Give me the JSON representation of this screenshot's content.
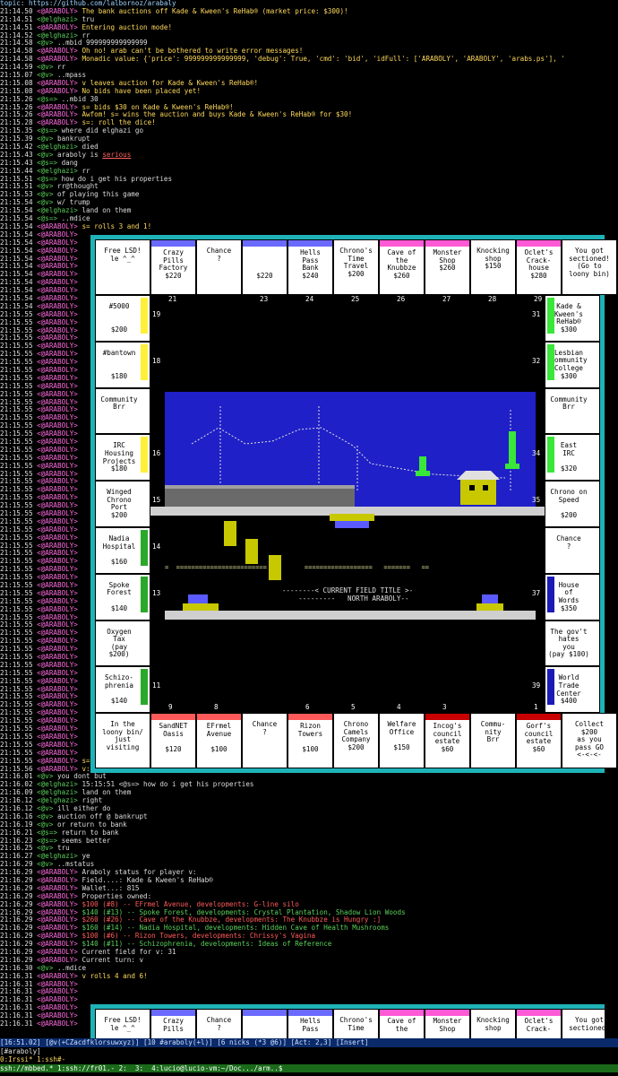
{
  "topic": "topic: https://github.com/lalbornoz/arabaly",
  "log": [
    [
      "21:14.50",
      "ARABOLY",
      "The bank auctions off Kade & Kween's ReHab® (market price: $300)!",
      "bot"
    ],
    [
      "21:14.51",
      "elghazi",
      "tru",
      "nk"
    ],
    [
      "21:14.51",
      "ARABOLY",
      "Entering auction mode!",
      "bot"
    ],
    [
      "21:14.52",
      "elghazi",
      "rr",
      "nk"
    ],
    [
      "21:14.58",
      "v",
      "..mbid 999999999999999",
      "nk"
    ],
    [
      "21:14.58",
      "ARABOLY",
      "Oh no! arab can't be bothered to write error messages!",
      "bot"
    ],
    [
      "21:14.58",
      "ARABOLY",
      "Monadic value: {'price': 999999999999999, 'debug': True, 'cmd': 'bid', 'idFull': ['ARABOLY', 'ARABOLY', 'arabs.ps'], '",
      "bot"
    ],
    [
      "21:14.59",
      "v",
      "rr",
      "nk"
    ],
    [
      "21:15.07",
      "v",
      "..mpass",
      "nk"
    ],
    [
      "21:15.08",
      "ARABOLY",
      "v leaves auction for Kade & Kween's ReHab®!",
      "bot"
    ],
    [
      "21:15.08",
      "ARABOLY",
      "No bids have been placed yet!",
      "bot"
    ],
    [
      "21:15.26",
      "s=",
      "..mbid 30",
      "nk"
    ],
    [
      "21:15.26",
      "ARABOLY",
      "s= bids $30 on Kade & Kween's ReHab®!",
      "bot"
    ],
    [
      "21:15.26",
      "ARABOLY",
      "Awfom! s= wins the auction and buys Kade & Kween's ReHab® for $30!",
      "bot"
    ],
    [
      "21:15.28",
      "ARABOLY",
      "s=: roll the dice!",
      "bot"
    ],
    [
      "21:15.35",
      "s=",
      "where did elghazi go",
      "nk"
    ],
    [
      "21:15.39",
      "v",
      "bankrupt",
      "nk"
    ],
    [
      "21:15.42",
      "elghazi",
      "died",
      "nk"
    ],
    [
      "21:15.43",
      "v",
      "araboly is ",
      "nk",
      "serious"
    ],
    [
      "21:15.43",
      "s=",
      "dang",
      "nk"
    ],
    [
      "21:15.44",
      "elghazi",
      "rr",
      "nk"
    ],
    [
      "21:15.51",
      "s=",
      "how do i get his properties",
      "nk"
    ],
    [
      "21:15.51",
      "v",
      "rr@thought",
      "nk"
    ],
    [
      "21:15.53",
      "v",
      "of playing this game",
      "nk"
    ],
    [
      "21:15.54",
      "v",
      "w/ trump",
      "nk"
    ],
    [
      "21:15.54",
      "elghazi",
      "land on them",
      "nk"
    ],
    [
      "21:15.54",
      "s=",
      "..mdice",
      "nk"
    ],
    [
      "21:15.54",
      "ARABOLY",
      "s= rolls 3 and 1!",
      "bot"
    ]
  ],
  "filler_times": [
    "21:15.54",
    "21:15.54",
    "21:15.54",
    "21:15.54",
    "21:15.54",
    "21:15.54",
    "21:15.54",
    "21:15.54",
    "21:15.54",
    "21:15.54",
    "21:15.55",
    "21:15.55",
    "21:15.55",
    "21:15.55",
    "21:15.55",
    "21:15.55",
    "21:15.55",
    "21:15.55",
    "21:15.55",
    "21:15.55",
    "21:15.55",
    "21:15.55",
    "21:15.55",
    "21:15.55",
    "21:15.55",
    "21:15.55",
    "21:15.55",
    "21:15.55",
    "21:15.55",
    "21:15.55",
    "21:15.55",
    "21:15.55",
    "21:15.55",
    "21:15.55",
    "21:15.55",
    "21:15.55",
    "21:15.55",
    "21:15.55",
    "21:15.55",
    "21:15.55",
    "21:15.55",
    "21:15.55",
    "21:15.55",
    "21:15.55",
    "21:15.55",
    "21:15.55",
    "21:15.55",
    "21:15.55",
    "21:15.55",
    "21:15.55",
    "21:15.55",
    "21:15.55",
    "21:15.55",
    "21:15.55",
    "21:15.55",
    "21:15.55",
    "21:15.55",
    "21:15.55",
    "21:15.55",
    "21:15.55",
    "21:15.55",
    "21:15.55",
    "21:15.55",
    "21:15.55",
    "21:15.55",
    "21:15.55"
  ],
  "log2": [
    [
      "21:15.55",
      "ARABOLY",
      "s= lands on Oclet's Crackhouse!",
      "bot"
    ],
    [
      "21:15.56",
      "ARABOLY",
      "v: roll the dice!",
      "bot"
    ],
    [
      "21:16.01",
      "v",
      "you dont but",
      "nk"
    ],
    [
      "21:16.02",
      "elghazi",
      "15:15:51 <@s=> how do i get his properties",
      "nk"
    ],
    [
      "21:16.09",
      "elghazi",
      "land on them",
      "nk"
    ],
    [
      "21:16.12",
      "elghazi",
      "right",
      "nk"
    ],
    [
      "21:16.12",
      "v",
      "ill either do",
      "nk"
    ],
    [
      "21:16.16",
      "v",
      "auction off @ bankrupt",
      "nk"
    ],
    [
      "21:16.19",
      "v",
      "or return to bank",
      "nk"
    ],
    [
      "21:16.21",
      "s=",
      "return to bank",
      "nk"
    ],
    [
      "21:16.23",
      "s=",
      "seems better",
      "nk"
    ],
    [
      "21:16.25",
      "v",
      "tru",
      "nk"
    ],
    [
      "21:16.27",
      "elghazi",
      "ye",
      "nk"
    ],
    [
      "21:16.29",
      "v",
      "..mstatus",
      "nk"
    ],
    [
      "21:16.29",
      "ARABOLY",
      "Araboly status for player v:",
      "plain"
    ],
    [
      "21:16.29",
      "ARABOLY",
      "Field....: Kade & Kween's ReHab®",
      "plain"
    ],
    [
      "21:16.29",
      "ARABOLY",
      "Wallet...: 815",
      "plain"
    ],
    [
      "21:16.29",
      "ARABOLY",
      "Properties owned:",
      "plain"
    ],
    [
      "21:16.29",
      "ARABOLY",
      "$100 (#8) -- EFrmel Avenue, developments: G-line silo",
      "red"
    ],
    [
      "21:16.29",
      "ARABOLY",
      "$140 (#13) -- Spoke Forest, developments: Crystal Plantation, Shadow Lion Woods",
      "grn"
    ],
    [
      "21:16.29",
      "ARABOLY",
      "$260 (#26) -- Cave of the Knubbze, developments: The Knubbze is Hungry :]",
      "red"
    ],
    [
      "21:16.29",
      "ARABOLY",
      "$160 (#14) -- Nadia Hospital, developments: Hidden Cave of Health Mushrooms",
      "grn"
    ],
    [
      "21:16.29",
      "ARABOLY",
      "$100 (#6) -- Rizon Towers, developments: Chrissy's Vagina",
      "red"
    ],
    [
      "21:16.29",
      "ARABOLY",
      "$140 (#11) -- Schizophrenia, developments: Ideas of Reference",
      "grn"
    ],
    [
      "21:16.29",
      "ARABOLY",
      "Current field for v: 31",
      "plain"
    ],
    [
      "21:16.29",
      "ARABOLY",
      "Current turn: v",
      "plain"
    ],
    [
      "21:16.30",
      "v",
      "..mdice",
      "nk"
    ],
    [
      "21:16.31",
      "ARABOLY",
      "v rolls 4 and 6!",
      "bot"
    ]
  ],
  "filler_times2": [
    "21:16.31",
    "21:16.31",
    "21:16.31",
    "21:16.31",
    "21:16.31",
    "21:16.31"
  ],
  "board": {
    "top": [
      {
        "name": "Free LSD!\nle ^_^",
        "color": ""
      },
      {
        "name": "Crazy\nPills\nFactory\n$220",
        "color": "#6a6aff"
      },
      {
        "name": "Chance\n?",
        "color": ""
      },
      {
        "name": "\n\n\n$220",
        "color": "#6a6aff"
      },
      {
        "name": "Hells\nPass\nBank\n$240",
        "color": "#6a6aff"
      },
      {
        "name": "Chrono's\nTime\nTravel\n$200",
        "color": ""
      },
      {
        "name": "Cave of\nthe\nKnubbze\n$260",
        "color": "#ff5ad5"
      },
      {
        "name": "Monster\nShop\n$260",
        "color": "#ff5ad5"
      },
      {
        "name": "Knocking\nshop\n$150",
        "color": ""
      },
      {
        "name": "Oclet's\nCrack-\nhouse\n$280",
        "color": "#ff5ad5"
      },
      {
        "name": "You got\nsectioned!\n(Go to\nloony bin)",
        "color": ""
      }
    ],
    "left": [
      {
        "name": "#5000\n\n\n$200",
        "color": "#ffef3a"
      },
      {
        "name": "#bantown\n\n\n$180",
        "color": "#ffef3a"
      },
      {
        "name": "Community\nBrr",
        "color": ""
      },
      {
        "name": "IRC\nHousing\nProjects\n$180",
        "color": "#ffef3a"
      },
      {
        "name": "Winged\nChrono\nPort\n$200",
        "color": ""
      },
      {
        "name": "Nadia\nHospital\n\n$160",
        "color": "#2aa82a"
      },
      {
        "name": "Spoke\nForest\n\n$140",
        "color": "#2aa82a"
      },
      {
        "name": "Oxygen\nTax\n(pay\n$200)",
        "color": ""
      },
      {
        "name": "Schizo-\nphrenia\n\n$140",
        "color": "#2aa82a"
      }
    ],
    "right": [
      {
        "name": "Kade &\nKween's\nReHab®\n$300",
        "color": "#39e639"
      },
      {
        "name": "Lesbian\nCommunity\nCollege\n$300",
        "color": "#39e639"
      },
      {
        "name": "Community\nBrr",
        "color": ""
      },
      {
        "name": "East\nIRC\n\n$320",
        "color": "#39e639"
      },
      {
        "name": "Chrono on\nSpeed\n\n$200",
        "color": ""
      },
      {
        "name": "Chance\n?",
        "color": ""
      },
      {
        "name": "House\nof\nWords\n$350",
        "color": "#1a1ab4"
      },
      {
        "name": "The gov't\nhates\nyou\n(pay $100)",
        "color": ""
      },
      {
        "name": "World\nTrade\nCenter\n$400",
        "color": "#1a1ab4"
      }
    ],
    "bottom": [
      {
        "name": "In the\nloony bin/\njust\nvisiting",
        "color": ""
      },
      {
        "name": "SandNET\nOasis\n\n$120",
        "color": "#ff5a5a"
      },
      {
        "name": "EFrmel\nAvenue\n\n$100",
        "color": "#ff5a5a"
      },
      {
        "name": "Chance\n?",
        "color": ""
      },
      {
        "name": "Rizon\nTowers\n\n$100",
        "color": "#ff5a5a"
      },
      {
        "name": "Chrono\nCamels\nCompany\n$200",
        "color": ""
      },
      {
        "name": "Welfare\nOffice\n\n$150",
        "color": ""
      },
      {
        "name": "Incog's\ncouncil\nestate\n$60",
        "color": "#c80000"
      },
      {
        "name": "Commu-\nnity\nBrr",
        "color": ""
      },
      {
        "name": "Gorf's\ncouncil\nestate\n$60",
        "color": "#c80000"
      },
      {
        "name": "Collect\n$200\nas you\npass GO\n<-<-<-",
        "color": ""
      }
    ],
    "top_numbers": [
      "21",
      "",
      "23",
      "24",
      "25",
      "26",
      "27",
      "28",
      "29"
    ],
    "bottom_numbers": [
      "9",
      "8",
      "",
      "6",
      "5",
      "4",
      "3",
      "",
      "1"
    ],
    "left_numbers": [
      "19",
      "18",
      "",
      "16",
      "15",
      "14",
      "13",
      "",
      "11"
    ],
    "right_numbers": [
      "31",
      "32",
      "",
      "34",
      "35",
      "",
      "37",
      "",
      "39"
    ],
    "field_title": "--------< CURRENT FIELD TITLE >-\n   ---------   NORTH ARABOLY--"
  },
  "board2_top": [
    {
      "name": "Free LSD!\nle ^_^",
      "color": ""
    },
    {
      "name": "Crazy\nPills",
      "color": "#6a6aff"
    },
    {
      "name": "Chance\n?",
      "color": ""
    },
    {
      "name": "",
      "color": "#6a6aff"
    },
    {
      "name": "Hells\nPass",
      "color": "#6a6aff"
    },
    {
      "name": "Chrono's\nTime",
      "color": ""
    },
    {
      "name": "Cave of\nthe",
      "color": "#ff5ad5"
    },
    {
      "name": "Monster\nShop",
      "color": "#ff5ad5"
    },
    {
      "name": "Knocking\nshop",
      "color": ""
    },
    {
      "name": "Oclet's\nCrack-",
      "color": "#ff5ad5"
    },
    {
      "name": "You got\nsectioned!",
      "color": ""
    }
  ],
  "status": {
    "line1": "[16:51.02] [@v(+CZacdfklorsuwxyz)] [10 #araboly(+l)] [6 nicks (*3 @6)] [Act: 2,3] [Insert]",
    "line2": "[#araboly] ",
    "line3": "0:Irssi* 1:ssh#-",
    "line4": "ssh://mbbed.* 1:ssh://fr01.- 2:  3:  4:lucio@lucio-vm:~/Doc.../arm..$"
  },
  "colors": {
    "frame": "#1fb3b8",
    "sky": "#1f20c8",
    "house": "#c8c800"
  }
}
